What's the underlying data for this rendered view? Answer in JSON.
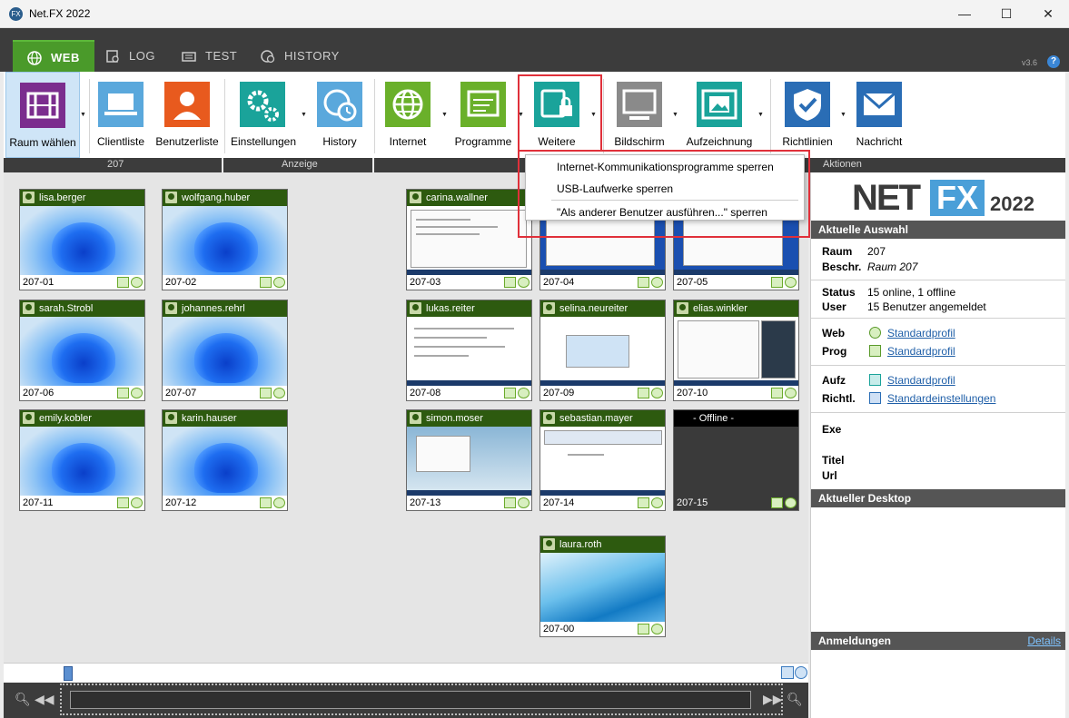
{
  "window": {
    "title": "Net.FX 2022",
    "app_icon": "netfx-icon",
    "minimize": "—",
    "maximize": "☐",
    "close": "✕"
  },
  "tabs": [
    {
      "label": "WEB",
      "icon": "globe-icon",
      "active": true
    },
    {
      "label": "LOG",
      "icon": "log-icon"
    },
    {
      "label": "TEST",
      "icon": "test-icon"
    },
    {
      "label": "HISTORY",
      "icon": "history-icon"
    }
  ],
  "version": "v3.6",
  "help": "?",
  "ribbon": {
    "buttons": [
      {
        "label": "Raum wählen",
        "icon": "room-icon",
        "color": "#7b2d8e",
        "dropdown": true
      },
      {
        "label": "Clientliste",
        "icon": "laptop-icon",
        "color": "#5aa8dc"
      },
      {
        "label": "Benutzerliste",
        "icon": "user-icon",
        "color": "#e85a1e"
      },
      {
        "label": "Einstellungen",
        "icon": "gears-icon",
        "color": "#1aa39a",
        "dropdown": true
      },
      {
        "label": "History",
        "icon": "history-globe-icon",
        "color": "#5aa8dc"
      },
      {
        "label": "Internet",
        "icon": "globe-icon",
        "color": "#6ab02a",
        "dropdown": true
      },
      {
        "label": "Programme",
        "icon": "program-icon",
        "color": "#6ab02a",
        "dropdown": true
      },
      {
        "label": "Weitere",
        "icon": "lock-device-icon",
        "color": "#1aa39a",
        "dropdown": true
      },
      {
        "label": "Bildschirm",
        "icon": "monitor-icon",
        "color": "#8a8a8a",
        "dropdown": true
      },
      {
        "label": "Aufzeichnung",
        "icon": "film-icon",
        "color": "#1aa39a",
        "dropdown": true
      },
      {
        "label": "Richtlinien",
        "icon": "shield-check-icon",
        "color": "#2a6db5",
        "dropdown": true
      },
      {
        "label": "Nachricht",
        "icon": "mail-icon",
        "color": "#2a6db5"
      }
    ],
    "groups": {
      "room": "207",
      "view": "Anzeige",
      "actions": "Aktionen"
    }
  },
  "dropdown_menu": {
    "items": [
      "Internet-Kommunikationsprogramme sperren",
      "USB-Laufwerke sperren",
      "\"Als anderer Benutzer ausführen...\" sperren"
    ]
  },
  "clients": [
    {
      "user": "lisa.berger",
      "pc": "207-01",
      "screen": "win11"
    },
    {
      "user": "wolfgang.huber",
      "pc": "207-02",
      "screen": "win11"
    },
    {
      "user": "sarah.Strobl",
      "pc": "207-06",
      "screen": "win11"
    },
    {
      "user": "johannes.rehrl",
      "pc": "207-07",
      "screen": "win11"
    },
    {
      "user": "emily.kobler",
      "pc": "207-11",
      "screen": "win11"
    },
    {
      "user": "karin.hauser",
      "pc": "207-12",
      "screen": "win11"
    },
    {
      "user": "carina.wallner",
      "pc": "207-03",
      "screen": "desktop"
    },
    {
      "user": "",
      "pc": "207-04",
      "screen": "desktop"
    },
    {
      "user": "",
      "pc": "207-05",
      "screen": "desktop"
    },
    {
      "user": "lukas.reiter",
      "pc": "207-08",
      "screen": "desktop"
    },
    {
      "user": "selina.neureiter",
      "pc": "207-09",
      "screen": "desktop"
    },
    {
      "user": "elias.winkler",
      "pc": "207-10",
      "screen": "desktop"
    },
    {
      "user": "simon.moser",
      "pc": "207-13",
      "screen": "desktop"
    },
    {
      "user": "sebastian.mayer",
      "pc": "207-14",
      "screen": "desktop"
    },
    {
      "user": "- Offline -",
      "pc": "207-15",
      "screen": "offline"
    },
    {
      "user": "laura.roth",
      "pc": "207-00",
      "screen": "laura"
    }
  ],
  "sidebar": {
    "logo": {
      "net": "NET",
      "fx": "FX",
      "year": "2022"
    },
    "current_selection": "Aktuelle Auswahl",
    "raum_label": "Raum",
    "raum": "207",
    "beschr_label": "Beschr.",
    "beschr": "Raum 207",
    "status_label": "Status",
    "status": "15 online, 1 offline",
    "user_label": "User",
    "user": "15 Benutzer angemeldet",
    "web_label": "Web",
    "web": "Standardprofil",
    "prog_label": "Prog",
    "prog": "Standardprofil",
    "aufz_label": "Aufz",
    "aufz": "Standardprofil",
    "richtl_label": "Richtl.",
    "richtl": "Standardeinstellungen",
    "exe_label": "Exe",
    "titel_label": "Titel",
    "url_label": "Url",
    "current_desktop": "Aktueller Desktop",
    "logins": "Anmeldungen",
    "details": "Details"
  }
}
